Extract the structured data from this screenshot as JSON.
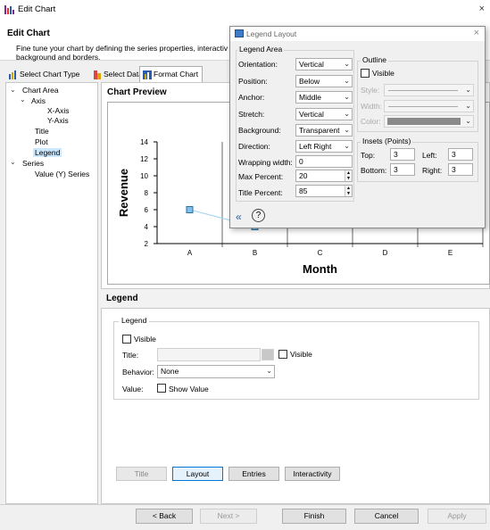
{
  "window": {
    "title": "Edit Chart",
    "close_glyph": "×"
  },
  "header": {
    "title": "Edit Chart",
    "desc_line1": "Fine tune your chart by defining the series properties, interactiv",
    "desc_line2": "background and borders."
  },
  "tabs": [
    {
      "label": "Select Chart Type",
      "icon": "chart-type-icon"
    },
    {
      "label": "Select Data",
      "icon": "select-data-icon"
    },
    {
      "label": "Format Chart",
      "icon": "format-chart-icon",
      "active": true
    }
  ],
  "tree": {
    "items": [
      {
        "label": "Chart Area",
        "expanded": true
      },
      {
        "label": "Axis",
        "expanded": true
      },
      {
        "label": "X-Axis"
      },
      {
        "label": "Y-Axis"
      },
      {
        "label": "Title"
      },
      {
        "label": "Plot"
      },
      {
        "label": "Legend",
        "selected": true
      },
      {
        "label": "Series",
        "expanded": true
      },
      {
        "label": "Value (Y) Series"
      }
    ]
  },
  "preview": {
    "title": "Chart Preview"
  },
  "chart_data": {
    "type": "line",
    "categories": [
      "A",
      "B",
      "C",
      "D",
      "E"
    ],
    "y_ticks": [
      2,
      4,
      6,
      8,
      10,
      12,
      14
    ],
    "ylim": [
      2,
      14
    ],
    "xlabel": "Month",
    "ylabel": "Revenue",
    "series": [
      {
        "values": [
          6,
          4
        ]
      }
    ],
    "colors": {
      "marker_fill": "#7ec0ee",
      "marker_stroke": "#2f6f9f",
      "line": "#9fd3f2",
      "grid": "#000000"
    }
  },
  "legend_section": {
    "header": "Legend",
    "group_title": "Legend",
    "visible_label": "Visible",
    "title_label": "Title:",
    "title_visible_label": "Visible",
    "behavior_label": "Behavior:",
    "behavior_value": "None",
    "value_label": "Value:",
    "show_value_label": "Show Value"
  },
  "format_buttons": [
    "Title",
    "Layout",
    "Entries",
    "Interactivity"
  ],
  "bottom_buttons": [
    {
      "label": "< Back"
    },
    {
      "label": "Next >"
    },
    {
      "label": "Finish"
    },
    {
      "label": "Cancel"
    },
    {
      "label": "Apply"
    }
  ],
  "popup": {
    "title": "Legend Layout",
    "close_glyph": "×",
    "legend_area_title": "Legend Area",
    "orientation_label": "Orientation:",
    "orientation_value": "Vertical",
    "position_label": "Position:",
    "position_value": "Below",
    "anchor_label": "Anchor:",
    "anchor_value": "Middle",
    "stretch_label": "Stretch:",
    "stretch_value": "Vertical",
    "background_label": "Background:",
    "background_value": "Transparent",
    "direction_label": "Direction:",
    "direction_value": "Left Right",
    "wrapping_label": "Wrapping width:",
    "wrapping_value": "0",
    "max_percent_label": "Max Percent:",
    "max_percent_value": "20",
    "title_percent_label": "Title Percent:",
    "title_percent_value": "85",
    "outline_title": "Outline",
    "outline_visible_label": "Visible",
    "style_label": "Style:",
    "width_label": "Width:",
    "color_label": "Color:",
    "insets_title": "Insets (Points)",
    "top_label": "Top:",
    "top_value": "3",
    "left_label": "Left:",
    "left_value": "3",
    "bottom_label": "Bottom:",
    "bottom_value": "3",
    "right_label": "Right:",
    "right_value": "3",
    "collapse_glyph": "«",
    "help_glyph": "?"
  }
}
